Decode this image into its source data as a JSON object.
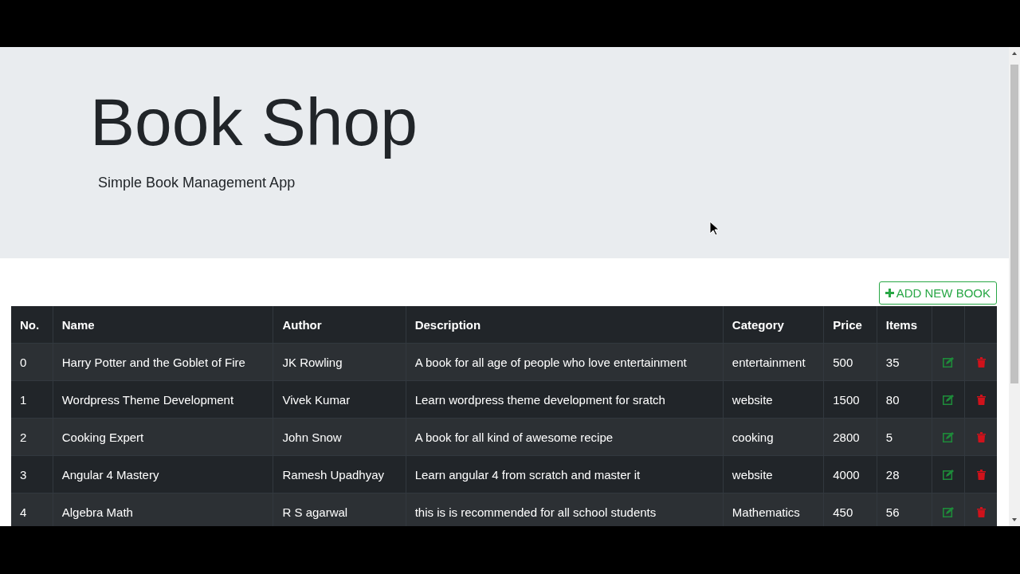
{
  "header": {
    "title": "Book Shop",
    "subtitle": "Simple Book Management App"
  },
  "add_button": {
    "label": "ADD NEW BOOK"
  },
  "table": {
    "columns": [
      "No.",
      "Name",
      "Author",
      "Description",
      "Category",
      "Price",
      "Items"
    ],
    "rows": [
      {
        "no": "0",
        "name": "Harry Potter and the Goblet of Fire",
        "author": "JK Rowling",
        "description": "A book for all age of people who love entertainment",
        "category": "entertainment",
        "price": "500",
        "items": "35"
      },
      {
        "no": "1",
        "name": "Wordpress Theme Development",
        "author": "Vivek Kumar",
        "description": "Learn wordpress theme development for sratch",
        "category": "website",
        "price": "1500",
        "items": "80"
      },
      {
        "no": "2",
        "name": "Cooking Expert",
        "author": "John Snow",
        "description": "A book for all kind of awesome recipe",
        "category": "cooking",
        "price": "2800",
        "items": "5"
      },
      {
        "no": "3",
        "name": "Angular 4 Mastery",
        "author": "Ramesh Upadhyay",
        "description": "Learn angular 4 from scratch and master it",
        "category": "website",
        "price": "4000",
        "items": "28"
      },
      {
        "no": "4",
        "name": "Algebra Math",
        "author": "R S agarwal",
        "description": "this is is recommended for all school students",
        "category": "Mathematics",
        "price": "450",
        "items": "56"
      }
    ]
  }
}
